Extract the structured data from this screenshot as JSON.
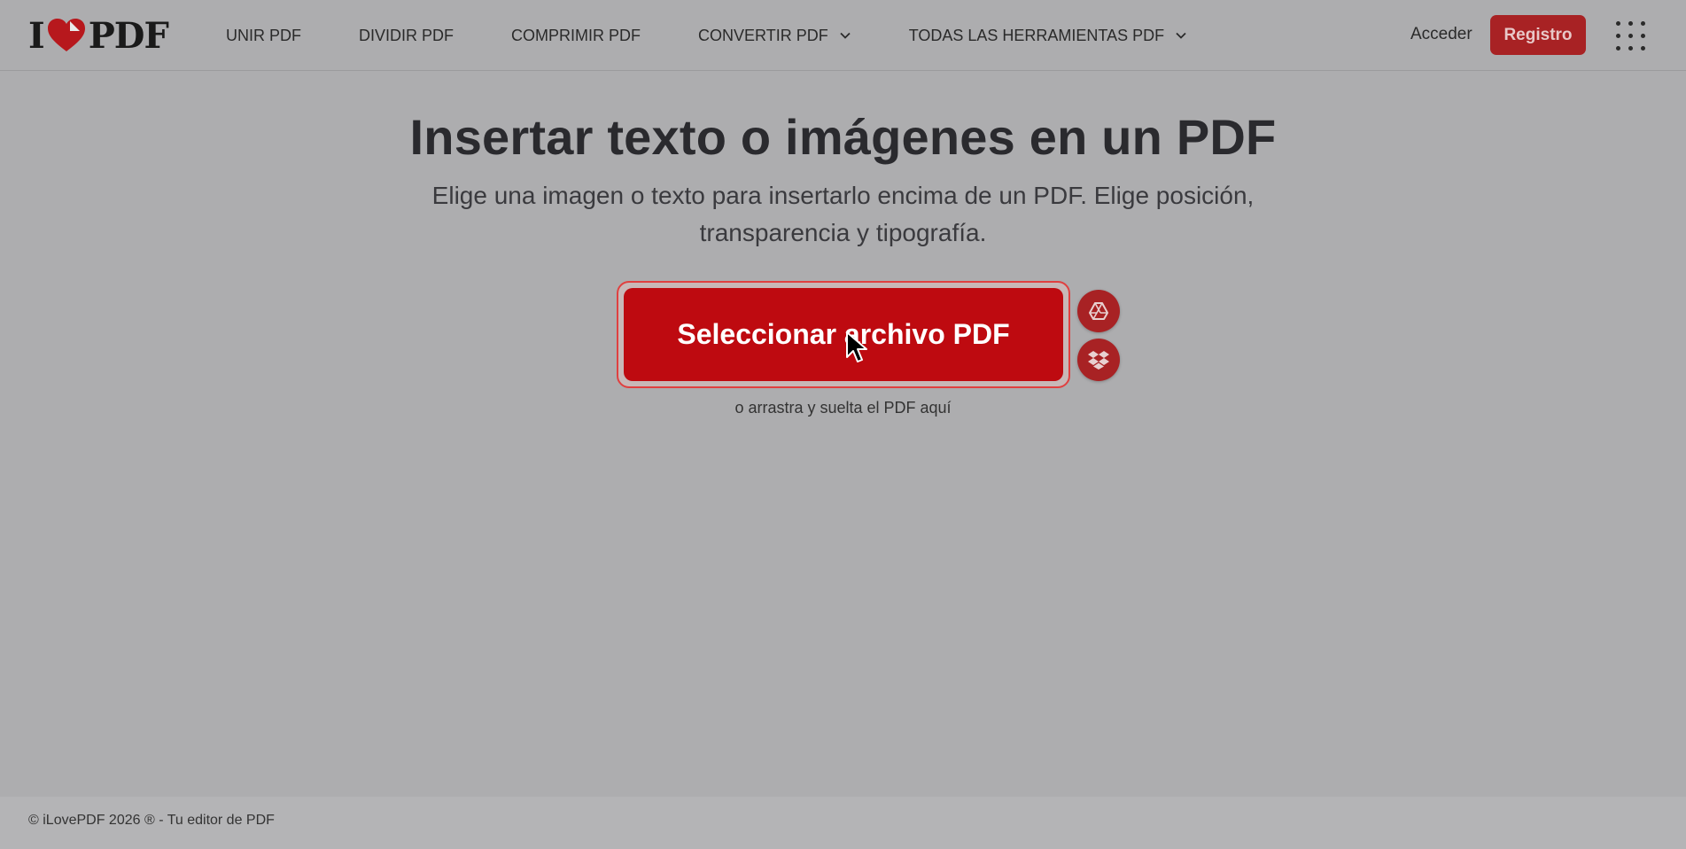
{
  "header": {
    "logo": {
      "left": "I",
      "right": "PDF",
      "heart_color": "#b7181d"
    },
    "nav": [
      {
        "label": "UNIR PDF"
      },
      {
        "label": "DIVIDIR PDF"
      },
      {
        "label": "COMPRIMIR PDF"
      },
      {
        "label": "CONVERTIR PDF"
      },
      {
        "label": "TODAS LAS HERRAMIENTAS PDF"
      }
    ],
    "login_label": "Acceder",
    "register_label": "Registro",
    "apps_icon": "grid-icon"
  },
  "main": {
    "title": "Insertar texto o imágenes en un PDF",
    "subtitle": "Elige una imagen o texto para insertarlo encima de un PDF. Elige posición, transparencia y tipografía.",
    "select_button_label": "Seleccionar archivo PDF",
    "drop_hint": "o arrastra y suelta el PDF aquí",
    "cloud_sources": [
      {
        "icon": "google-drive-icon"
      },
      {
        "icon": "dropbox-icon"
      }
    ]
  },
  "footer": {
    "text": "© iLovePDF 2026 ® - Tu editor de PDF"
  },
  "colors": {
    "accent": "#be0a10",
    "accent_dark": "#a82224",
    "overlay_bg": "#adadaf"
  }
}
